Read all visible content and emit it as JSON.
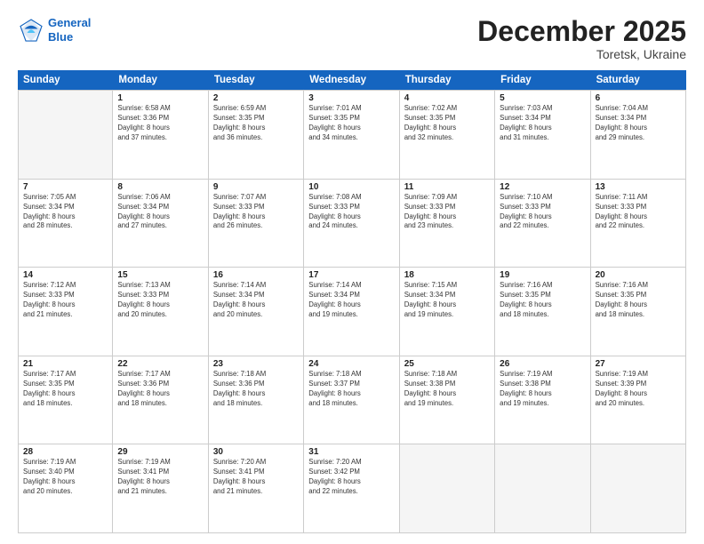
{
  "logo": {
    "line1": "General",
    "line2": "Blue"
  },
  "title": "December 2025",
  "location": "Toretsk, Ukraine",
  "header_days": [
    "Sunday",
    "Monday",
    "Tuesday",
    "Wednesday",
    "Thursday",
    "Friday",
    "Saturday"
  ],
  "weeks": [
    [
      {
        "day": "",
        "info": "",
        "empty": true
      },
      {
        "day": "1",
        "info": "Sunrise: 6:58 AM\nSunset: 3:36 PM\nDaylight: 8 hours\nand 37 minutes."
      },
      {
        "day": "2",
        "info": "Sunrise: 6:59 AM\nSunset: 3:35 PM\nDaylight: 8 hours\nand 36 minutes."
      },
      {
        "day": "3",
        "info": "Sunrise: 7:01 AM\nSunset: 3:35 PM\nDaylight: 8 hours\nand 34 minutes."
      },
      {
        "day": "4",
        "info": "Sunrise: 7:02 AM\nSunset: 3:35 PM\nDaylight: 8 hours\nand 32 minutes."
      },
      {
        "day": "5",
        "info": "Sunrise: 7:03 AM\nSunset: 3:34 PM\nDaylight: 8 hours\nand 31 minutes."
      },
      {
        "day": "6",
        "info": "Sunrise: 7:04 AM\nSunset: 3:34 PM\nDaylight: 8 hours\nand 29 minutes."
      }
    ],
    [
      {
        "day": "7",
        "info": "Sunrise: 7:05 AM\nSunset: 3:34 PM\nDaylight: 8 hours\nand 28 minutes."
      },
      {
        "day": "8",
        "info": "Sunrise: 7:06 AM\nSunset: 3:34 PM\nDaylight: 8 hours\nand 27 minutes."
      },
      {
        "day": "9",
        "info": "Sunrise: 7:07 AM\nSunset: 3:33 PM\nDaylight: 8 hours\nand 26 minutes."
      },
      {
        "day": "10",
        "info": "Sunrise: 7:08 AM\nSunset: 3:33 PM\nDaylight: 8 hours\nand 24 minutes."
      },
      {
        "day": "11",
        "info": "Sunrise: 7:09 AM\nSunset: 3:33 PM\nDaylight: 8 hours\nand 23 minutes."
      },
      {
        "day": "12",
        "info": "Sunrise: 7:10 AM\nSunset: 3:33 PM\nDaylight: 8 hours\nand 22 minutes."
      },
      {
        "day": "13",
        "info": "Sunrise: 7:11 AM\nSunset: 3:33 PM\nDaylight: 8 hours\nand 22 minutes."
      }
    ],
    [
      {
        "day": "14",
        "info": "Sunrise: 7:12 AM\nSunset: 3:33 PM\nDaylight: 8 hours\nand 21 minutes."
      },
      {
        "day": "15",
        "info": "Sunrise: 7:13 AM\nSunset: 3:33 PM\nDaylight: 8 hours\nand 20 minutes."
      },
      {
        "day": "16",
        "info": "Sunrise: 7:14 AM\nSunset: 3:34 PM\nDaylight: 8 hours\nand 20 minutes."
      },
      {
        "day": "17",
        "info": "Sunrise: 7:14 AM\nSunset: 3:34 PM\nDaylight: 8 hours\nand 19 minutes."
      },
      {
        "day": "18",
        "info": "Sunrise: 7:15 AM\nSunset: 3:34 PM\nDaylight: 8 hours\nand 19 minutes."
      },
      {
        "day": "19",
        "info": "Sunrise: 7:16 AM\nSunset: 3:35 PM\nDaylight: 8 hours\nand 18 minutes."
      },
      {
        "day": "20",
        "info": "Sunrise: 7:16 AM\nSunset: 3:35 PM\nDaylight: 8 hours\nand 18 minutes."
      }
    ],
    [
      {
        "day": "21",
        "info": "Sunrise: 7:17 AM\nSunset: 3:35 PM\nDaylight: 8 hours\nand 18 minutes."
      },
      {
        "day": "22",
        "info": "Sunrise: 7:17 AM\nSunset: 3:36 PM\nDaylight: 8 hours\nand 18 minutes."
      },
      {
        "day": "23",
        "info": "Sunrise: 7:18 AM\nSunset: 3:36 PM\nDaylight: 8 hours\nand 18 minutes."
      },
      {
        "day": "24",
        "info": "Sunrise: 7:18 AM\nSunset: 3:37 PM\nDaylight: 8 hours\nand 18 minutes."
      },
      {
        "day": "25",
        "info": "Sunrise: 7:18 AM\nSunset: 3:38 PM\nDaylight: 8 hours\nand 19 minutes."
      },
      {
        "day": "26",
        "info": "Sunrise: 7:19 AM\nSunset: 3:38 PM\nDaylight: 8 hours\nand 19 minutes."
      },
      {
        "day": "27",
        "info": "Sunrise: 7:19 AM\nSunset: 3:39 PM\nDaylight: 8 hours\nand 20 minutes."
      }
    ],
    [
      {
        "day": "28",
        "info": "Sunrise: 7:19 AM\nSunset: 3:40 PM\nDaylight: 8 hours\nand 20 minutes."
      },
      {
        "day": "29",
        "info": "Sunrise: 7:19 AM\nSunset: 3:41 PM\nDaylight: 8 hours\nand 21 minutes."
      },
      {
        "day": "30",
        "info": "Sunrise: 7:20 AM\nSunset: 3:41 PM\nDaylight: 8 hours\nand 21 minutes."
      },
      {
        "day": "31",
        "info": "Sunrise: 7:20 AM\nSunset: 3:42 PM\nDaylight: 8 hours\nand 22 minutes."
      },
      {
        "day": "",
        "info": "",
        "empty": true
      },
      {
        "day": "",
        "info": "",
        "empty": true
      },
      {
        "day": "",
        "info": "",
        "empty": true
      }
    ]
  ]
}
